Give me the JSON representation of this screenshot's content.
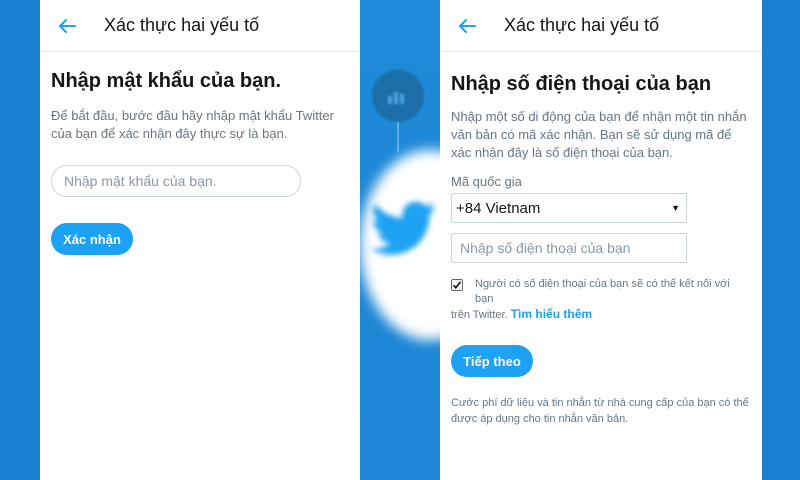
{
  "left": {
    "title": "Xác thực hai yếu tố",
    "heading": "Nhập mật khẩu của bạn.",
    "description": "Để bắt đầu, bước đầu hãy nhập mật khẩu Twitter của bạn để xác nhận đây thực sự là bạn.",
    "password_placeholder": "Nhập mật khẩu của bạn.",
    "confirm_label": "Xác nhận"
  },
  "right": {
    "title": "Xác thực hai yếu tố",
    "heading": "Nhập số điện thoại của bạn",
    "description": "Nhập một số di động của bạn để nhận một tin nhắn văn bản có mã xác nhận. Bạn sẽ sử dụng mã để xác nhận đây là số điện thoại của bạn.",
    "country_label": "Mã quốc gia",
    "country_value": "+84 Vietnam",
    "phone_placeholder": "Nhập số điện thoại của bạn",
    "checkbox_checked": true,
    "checkbox_text_line1": "Người có số điện thoại của bạn sẽ có thể kết nối với bạn",
    "checkbox_text_line2": "trên Twitter.",
    "learn_more": "Tìm hiểu thêm",
    "next_label": "Tiếp theo",
    "note": "Cước phí dữ liệu và tin nhắn từ nhà cung cấp của bạn có thể được áp dụng cho tin nhắn văn bản."
  },
  "colors": {
    "accent": "#1da1f2",
    "background": "#1d86d6",
    "text": "#14171a",
    "muted": "#657786"
  },
  "icons": [
    "back-arrow-icon",
    "chevron-down-icon",
    "checkmark-icon",
    "twitter-bird-icon",
    "analytics-icon"
  ]
}
